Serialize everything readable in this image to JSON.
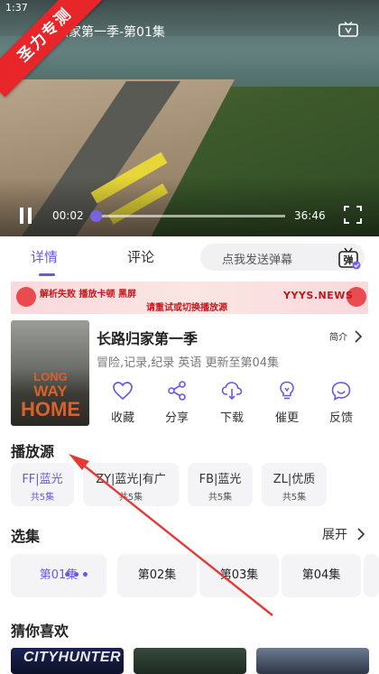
{
  "status_bar": {
    "time": "1:37"
  },
  "watermark": {
    "text": "圣力专测"
  },
  "player": {
    "episode_title": "归家第一季-第01集",
    "current_time": "00:02",
    "total_time": "36:46",
    "progress_fraction": 0.02
  },
  "tabs": [
    {
      "label": "详情",
      "active": true
    },
    {
      "label": "评论",
      "active": false
    }
  ],
  "danmu": {
    "placeholder": "点我发送弹幕",
    "icon_text": "弹"
  },
  "banner": {
    "line1": "解析失败  播放卡顿  黑屏",
    "line2": "请重试或切换播放源",
    "brand": "YYYS.NEWS"
  },
  "show": {
    "title": "长路归家第一季",
    "intro_label": "简介",
    "meta": "冒险,记录,纪录 英语 更新至第04集",
    "poster_text": [
      "LONG",
      "WAY",
      "HOME"
    ]
  },
  "actions": [
    {
      "label": "收藏",
      "icon": "heart-icon"
    },
    {
      "label": "分享",
      "icon": "share-icon"
    },
    {
      "label": "下载",
      "icon": "download-icon"
    },
    {
      "label": "催更",
      "icon": "lightbulb-icon"
    },
    {
      "label": "反馈",
      "icon": "feedback-icon"
    }
  ],
  "sources_section": {
    "title": "播放源",
    "items": [
      {
        "name": "FF|蓝光",
        "count": "共5集",
        "active": true
      },
      {
        "name": "ZY|蓝光|有广",
        "count": "共5集",
        "active": false
      },
      {
        "name": "FB|蓝光",
        "count": "共5集",
        "active": false
      },
      {
        "name": "ZL|优质",
        "count": "共5集",
        "active": false
      }
    ]
  },
  "episodes_section": {
    "title": "选集",
    "expand_label": "展开",
    "items": [
      {
        "label": "第01集",
        "active": true
      },
      {
        "label": "第02集",
        "active": false
      },
      {
        "label": "第03集",
        "active": false
      },
      {
        "label": "第04集",
        "active": false
      }
    ]
  },
  "recommend_section": {
    "title": "猜你喜欢",
    "first_thumb_text": "CITYHUNTER"
  },
  "colors": {
    "accent": "#6b56e6",
    "watermark_red": "#e8262a",
    "annotation_red": "#e53935"
  }
}
